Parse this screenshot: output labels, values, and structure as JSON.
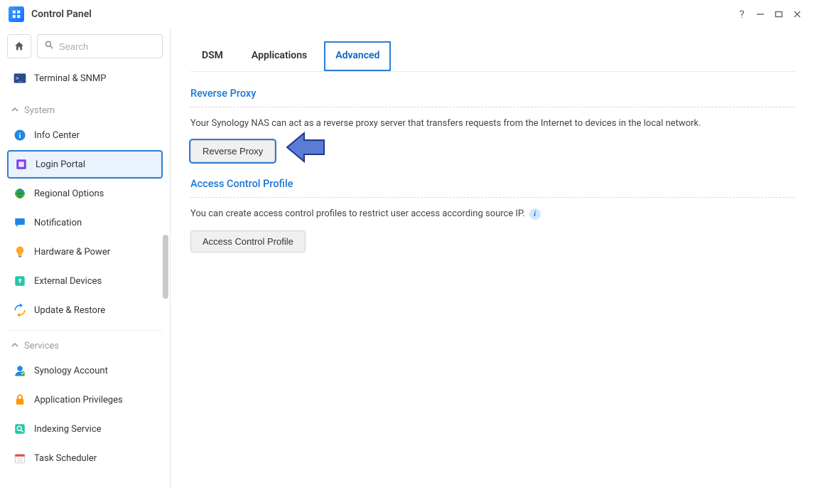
{
  "window": {
    "title": "Control Panel"
  },
  "sidebar": {
    "search_placeholder": "Search",
    "top_item": {
      "label": "Terminal & SNMP"
    },
    "sections": [
      {
        "label": "System",
        "items": [
          {
            "label": "Info Center"
          },
          {
            "label": "Login Portal"
          },
          {
            "label": "Regional Options"
          },
          {
            "label": "Notification"
          },
          {
            "label": "Hardware & Power"
          },
          {
            "label": "External Devices"
          },
          {
            "label": "Update & Restore"
          }
        ]
      },
      {
        "label": "Services",
        "items": [
          {
            "label": "Synology Account"
          },
          {
            "label": "Application Privileges"
          },
          {
            "label": "Indexing Service"
          },
          {
            "label": "Task Scheduler"
          }
        ]
      }
    ]
  },
  "tabs": [
    {
      "label": "DSM"
    },
    {
      "label": "Applications"
    },
    {
      "label": "Advanced"
    }
  ],
  "content": {
    "reverse_proxy": {
      "title": "Reverse Proxy",
      "desc": "Your Synology NAS can act as a reverse proxy server that transfers requests from the Internet to devices in the local network.",
      "button": "Reverse Proxy"
    },
    "acp": {
      "title": "Access Control Profile",
      "desc": "You can create access control profiles to restrict user access according source IP.",
      "button": "Access Control Profile"
    }
  }
}
